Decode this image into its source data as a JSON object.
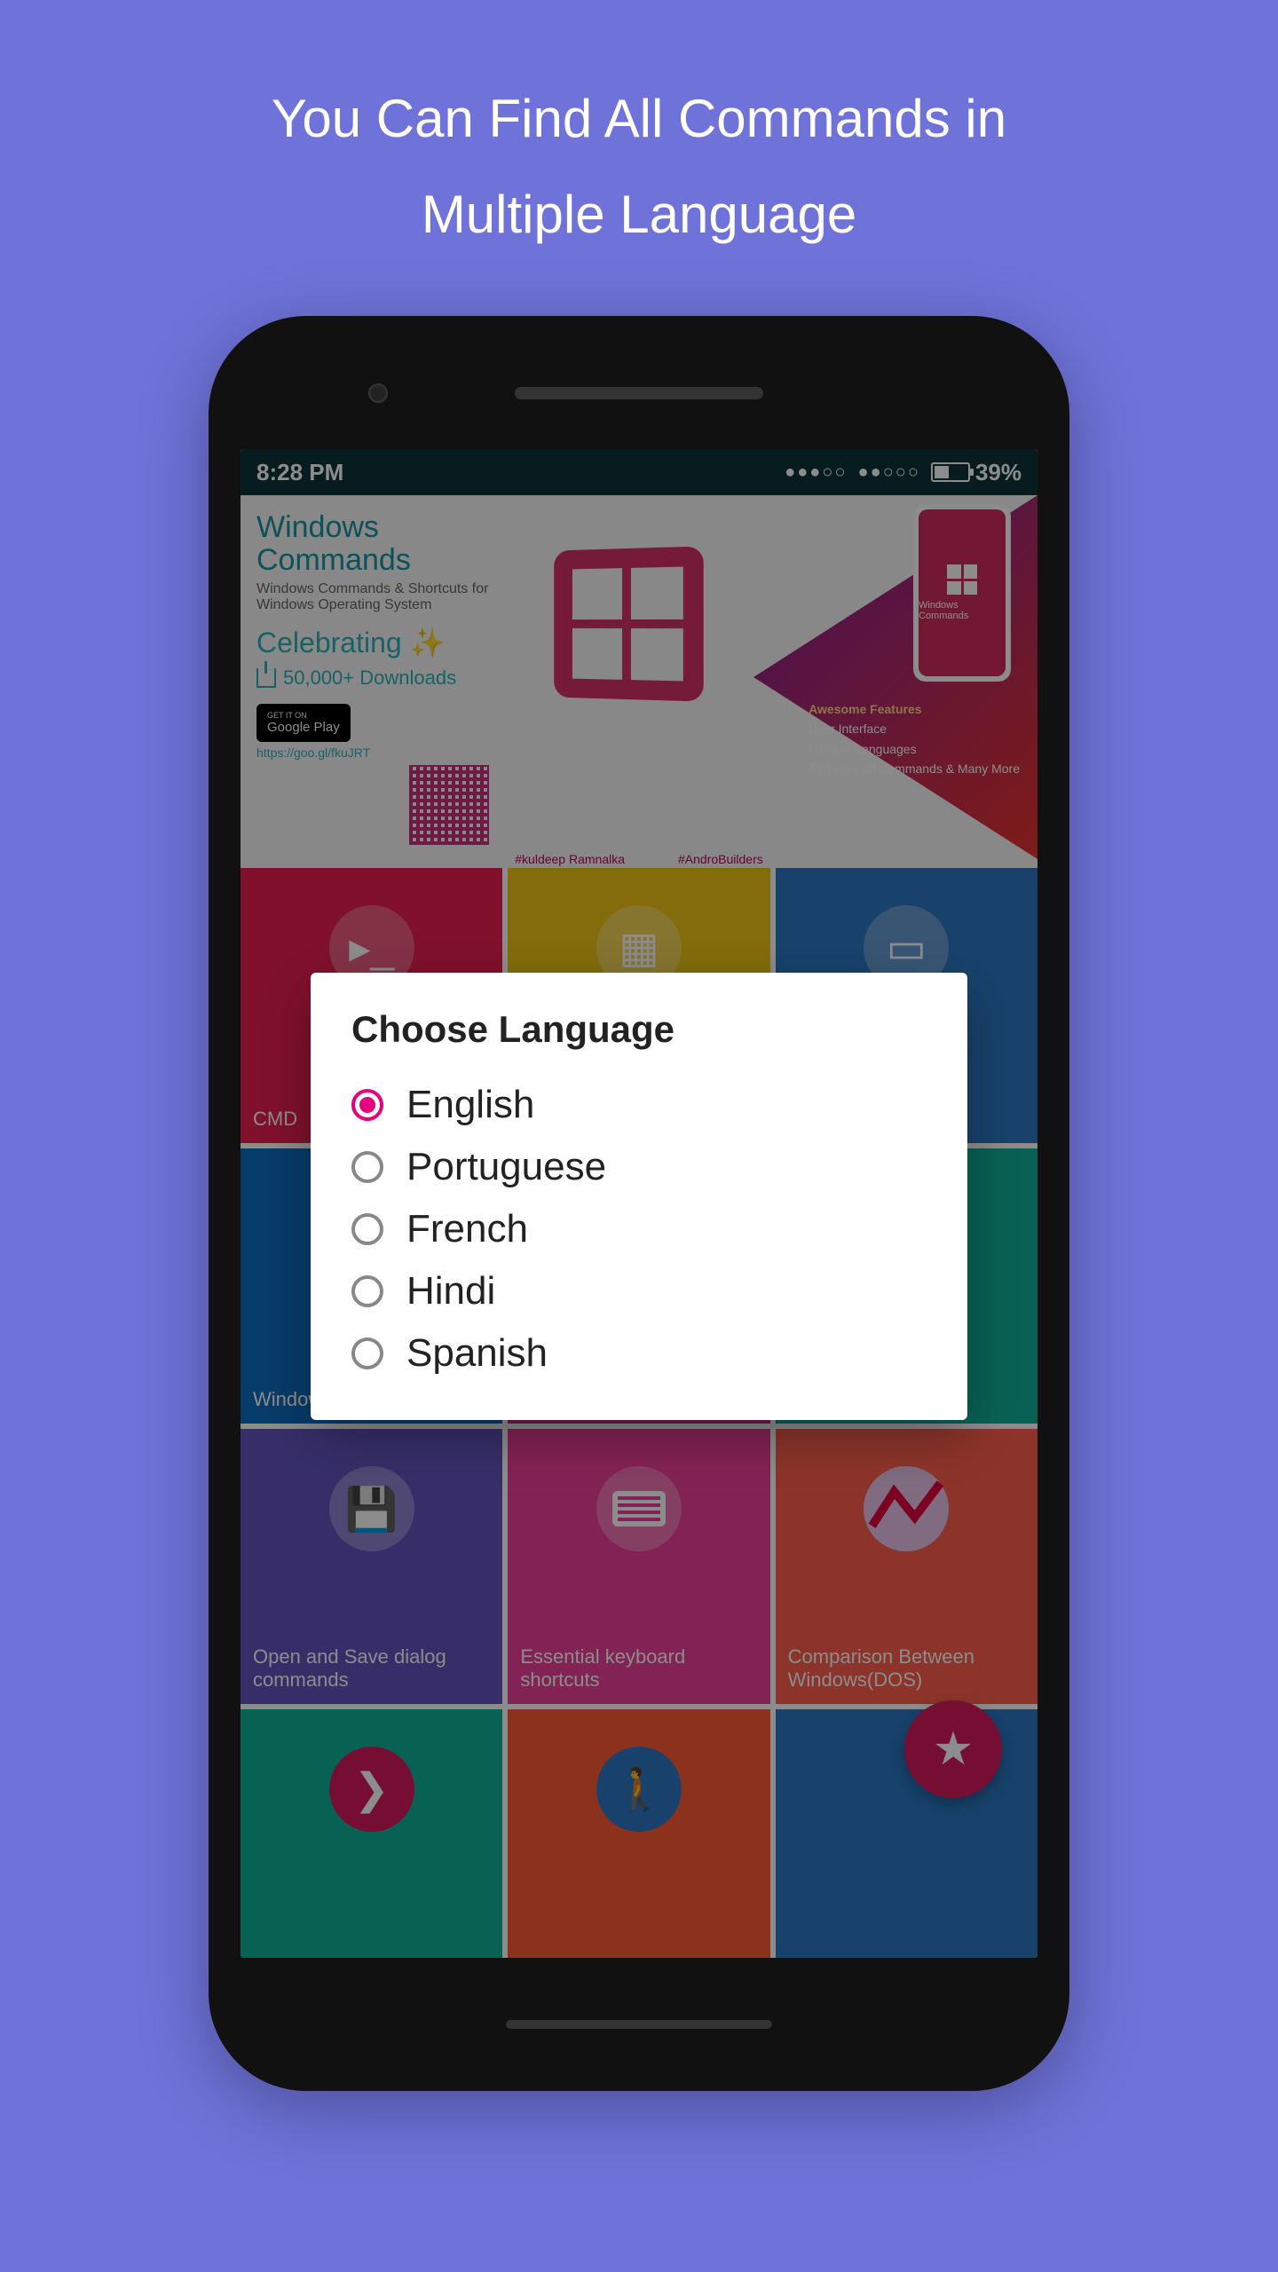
{
  "promo": {
    "line1": "You Can Find All Commands in",
    "line2": "Multiple Language"
  },
  "statusbar": {
    "time": "8:28 PM",
    "battery_pct": "39%"
  },
  "hero": {
    "title1": "Windows",
    "title2": "Commands",
    "subtitle": "Windows Commands & Shortcuts for Windows Operating System",
    "celebrate": "Celebrating",
    "downloads": "50,000+ Downloads",
    "gplay_top": "GET IT ON",
    "gplay_main": "Google Play",
    "gplay_url": "https://goo.gl/fkuJRT",
    "mini_title": "Windows Commands",
    "feat_head": "Awesome Features",
    "feat1": "User Interface",
    "feat2": "Multiple Languages",
    "feat3": "All Types Of Commands & Many More",
    "credit1": "#kuldeep Ramnalka",
    "credit2": "#AndroBuilders"
  },
  "tiles": [
    {
      "label": "CMD"
    },
    {
      "label": ""
    },
    {
      "label": ""
    },
    {
      "label": "Windows Commands"
    },
    {
      "label": ""
    },
    {
      "label": ""
    },
    {
      "label": "Open and Save dialog commands"
    },
    {
      "label": "Essential keyboard shortcuts"
    },
    {
      "label": "Comparison Between Windows(DOS)"
    },
    {
      "label": ""
    },
    {
      "label": ""
    },
    {
      "label": ""
    }
  ],
  "dialog": {
    "title": "Choose Language",
    "options": [
      "English",
      "Portuguese",
      "French",
      "Hindi",
      "Spanish"
    ],
    "selected": 0
  }
}
